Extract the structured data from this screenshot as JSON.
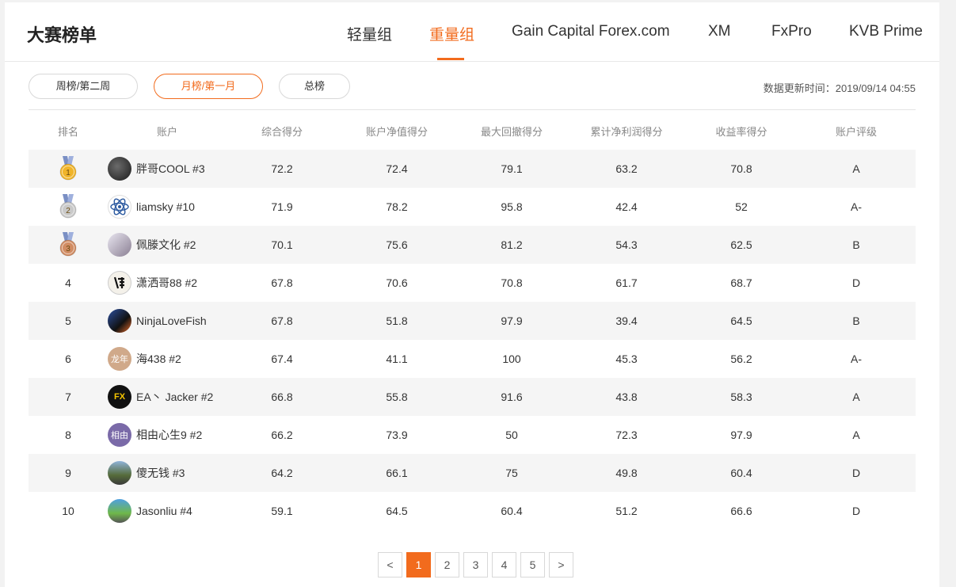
{
  "header": {
    "title": "大赛榜单",
    "tabs": [
      "轻量组",
      "重量组",
      "Gain Capital Forex.com",
      "XM",
      "FxPro",
      "KVB Prime"
    ],
    "active_tab": "重量组"
  },
  "filters": {
    "buttons": [
      "周榜/第二周",
      "月榜/第一月",
      "总榜"
    ],
    "active": "月榜/第一月",
    "update_label": "数据更新时间：2019/09/14 04:55"
  },
  "table": {
    "columns": [
      "排名",
      "账户",
      "综合得分",
      "账户净值得分",
      "最大回撤得分",
      "累计净利润得分",
      "收益率得分",
      "账户评级"
    ],
    "rows": [
      {
        "rank": "1",
        "medal": "gold",
        "name": "胖哥COOL #3",
        "avatar": "dark-photo-avatar",
        "total": "72.2",
        "equity": "72.4",
        "drawdown": "79.1",
        "profit": "63.2",
        "yield": "70.8",
        "rating": "A"
      },
      {
        "rank": "2",
        "medal": "silver",
        "name": "liamsky #10",
        "avatar": "atom-avatar",
        "total": "71.9",
        "equity": "78.2",
        "drawdown": "95.8",
        "profit": "42.4",
        "yield": "52",
        "rating": "A-"
      },
      {
        "rank": "3",
        "medal": "bronze",
        "name": "佩滕文化 #2",
        "avatar": "figure-avatar",
        "total": "70.1",
        "equity": "75.6",
        "drawdown": "81.2",
        "profit": "54.3",
        "yield": "62.5",
        "rating": "B"
      },
      {
        "rank": "4",
        "medal": "",
        "name": "潇洒哥88 #2",
        "avatar": "calligraphy-avatar",
        "total": "67.8",
        "equity": "70.6",
        "drawdown": "70.8",
        "profit": "61.7",
        "yield": "68.7",
        "rating": "D"
      },
      {
        "rank": "5",
        "medal": "",
        "name": "NinjaLoveFish",
        "avatar": "ninja-avatar",
        "total": "67.8",
        "equity": "51.8",
        "drawdown": "97.9",
        "profit": "39.4",
        "yield": "64.5",
        "rating": "B"
      },
      {
        "rank": "6",
        "medal": "",
        "name": "海438 #2",
        "avatar": "text-avatar",
        "avatar_text": "龙年",
        "total": "67.4",
        "equity": "41.1",
        "drawdown": "100",
        "profit": "45.3",
        "yield": "56.2",
        "rating": "A-"
      },
      {
        "rank": "7",
        "medal": "",
        "name": "EA丶 Jacker #2",
        "avatar": "fx-avatar",
        "avatar_text": "FX",
        "total": "66.8",
        "equity": "55.8",
        "drawdown": "91.6",
        "profit": "43.8",
        "yield": "58.3",
        "rating": "A"
      },
      {
        "rank": "8",
        "medal": "",
        "name": "相由心生9 #2",
        "avatar": "text-avatar",
        "avatar_text": "相由",
        "total": "66.2",
        "equity": "73.9",
        "drawdown": "50",
        "profit": "72.3",
        "yield": "97.9",
        "rating": "A"
      },
      {
        "rank": "9",
        "medal": "",
        "name": "傻无钱 #3",
        "avatar": "landscape-avatar",
        "total": "64.2",
        "equity": "66.1",
        "drawdown": "75",
        "profit": "49.8",
        "yield": "60.4",
        "rating": "D"
      },
      {
        "rank": "10",
        "medal": "",
        "name": "Jasonliu #4",
        "avatar": "road-avatar",
        "total": "59.1",
        "equity": "64.5",
        "drawdown": "60.4",
        "profit": "51.2",
        "yield": "66.6",
        "rating": "D"
      }
    ]
  },
  "pagination": {
    "prev": "<",
    "pages": [
      "1",
      "2",
      "3",
      "4",
      "5"
    ],
    "current": "1",
    "next": ">"
  },
  "colors": {
    "accent": "#f26b1d",
    "gold": "#f0b429",
    "silver": "#c9c9c9",
    "bronze": "#d18c63",
    "ribbon": "#7a8fc4"
  }
}
